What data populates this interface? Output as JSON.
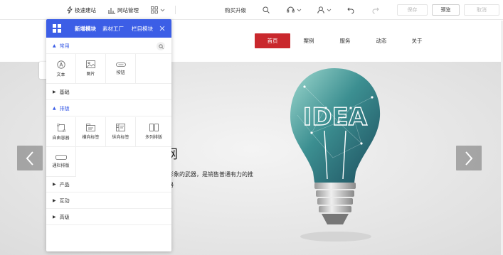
{
  "toolbar": {
    "quick_build": "极速建站",
    "site_manage": "网站管理",
    "buy_upgrade": "购买升级",
    "save": "保存",
    "preview": "预览",
    "cancel": "取消"
  },
  "site": {
    "nav": [
      "首页",
      "案例",
      "服务",
      "动态",
      "关于"
    ],
    "banner_heading_fragment": "网",
    "banner_line1": "形象的武器，是销售普通有力的推",
    "banner_line2": "器",
    "bulb_text": "IDEA"
  },
  "panel": {
    "tabs": [
      "新增模块",
      "素材工厂",
      "栏目模块"
    ],
    "sections": {
      "common": "常用",
      "basic": "基础",
      "layout": "排版",
      "product": "产品",
      "interaction": "互动",
      "advanced": "高级"
    },
    "common_items": [
      "文本",
      "图片",
      "按钮"
    ],
    "layout_items": [
      "自由容器",
      "横向标签",
      "纵向标签",
      "多列排版",
      "通栏排版"
    ]
  },
  "colors": {
    "accent": "#3c5ee6",
    "nav_active": "#c9282d"
  }
}
